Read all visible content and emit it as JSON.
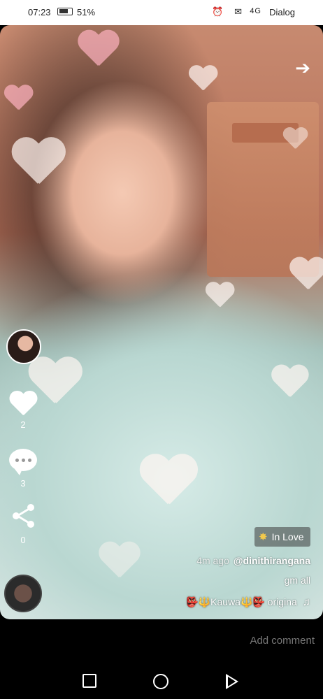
{
  "status_bar": {
    "time": "07:23",
    "battery_pct": "51%",
    "signal": "4G",
    "carrier": "Dialog"
  },
  "video": {
    "share_arrow_icon": "arrow-right-icon"
  },
  "side_actions": {
    "like_count": "2",
    "comment_count": "3",
    "share_count": "0"
  },
  "effect": {
    "label": "In Love",
    "icon": "sparkle-star-icon"
  },
  "post": {
    "username": "@dinithirangana",
    "time_ago": "4m ago",
    "caption": "gm all",
    "sound_text": "👺🔱Kauwa🔱👺 origina"
  },
  "comment_bar": {
    "placeholder": "Add comment"
  },
  "colors": {
    "status_bar_bg": "#ffffff",
    "background": "#000000",
    "effect_star": "#f2c94c"
  }
}
